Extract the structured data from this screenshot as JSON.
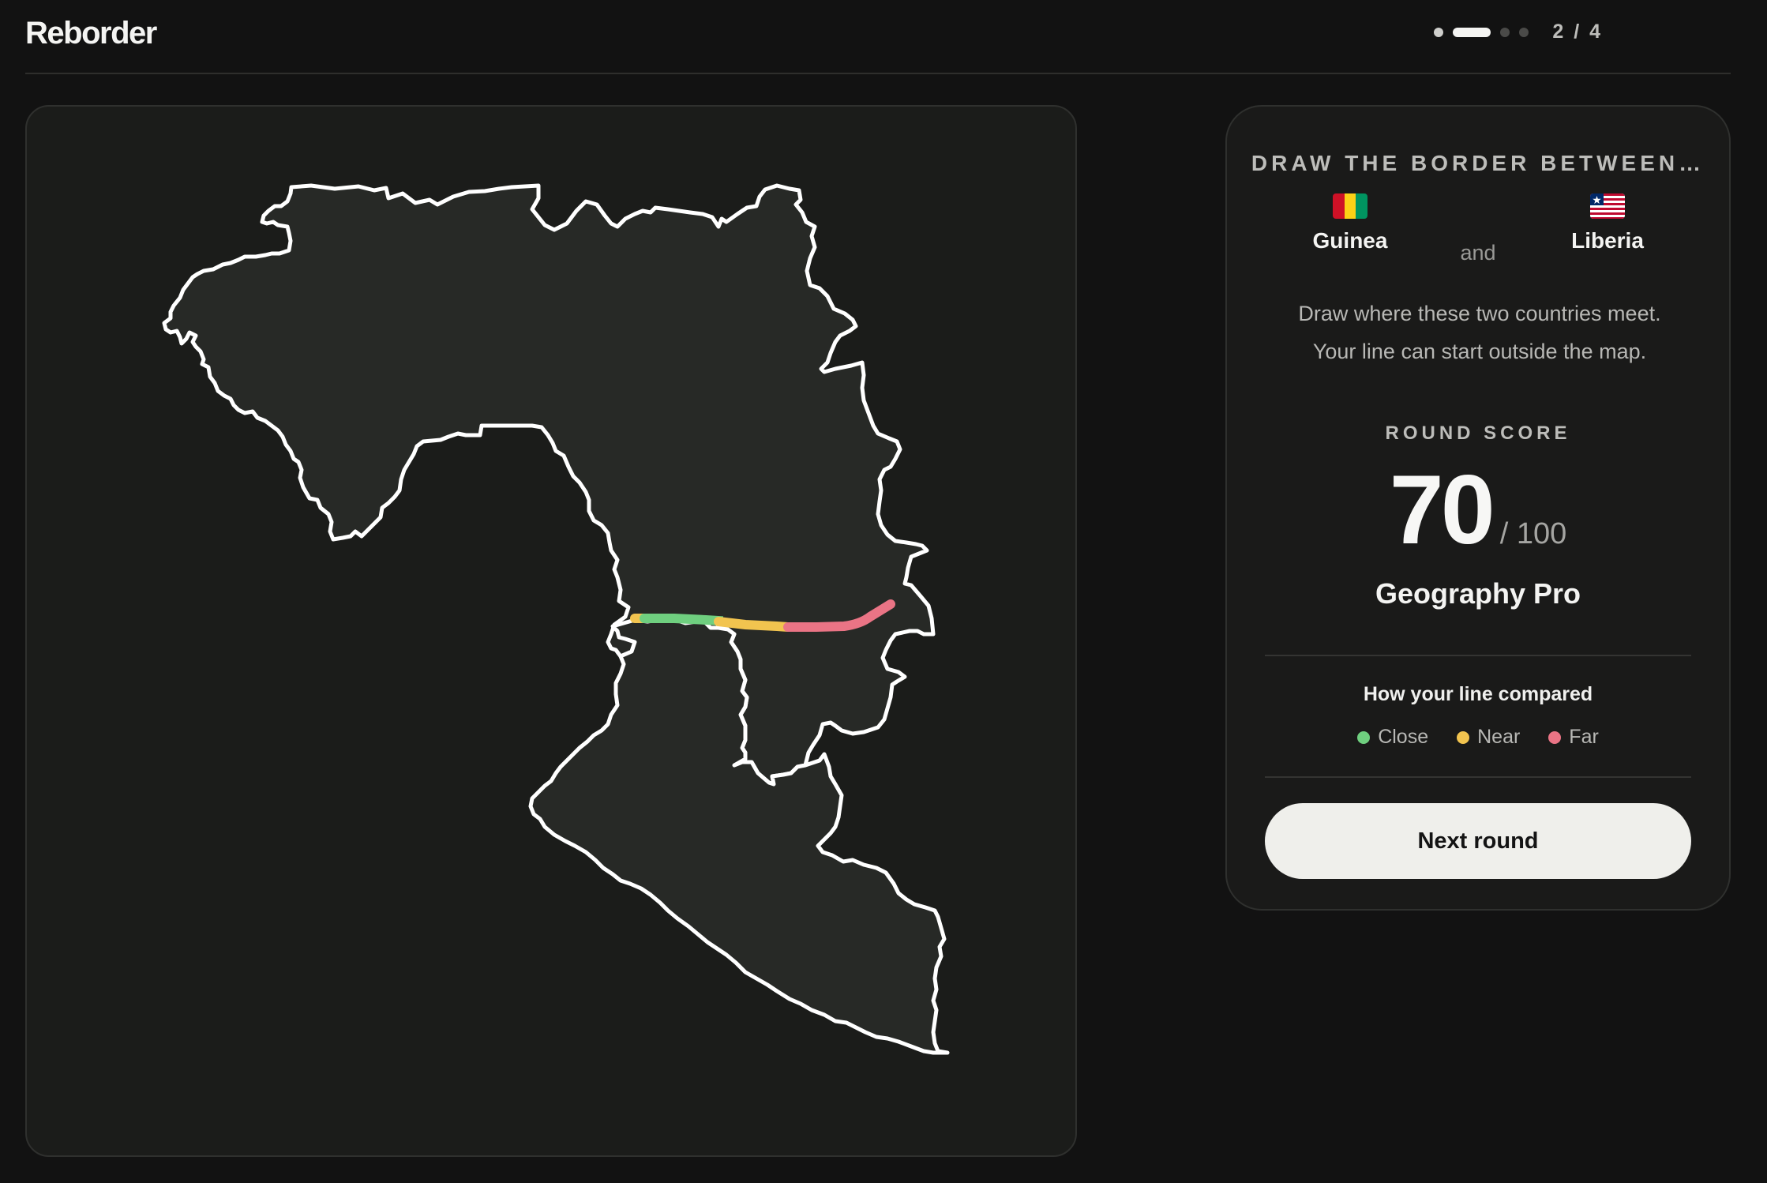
{
  "app": {
    "title": "Reborder"
  },
  "progress": {
    "current": 2,
    "total": 4,
    "label": "2 / 4"
  },
  "prompt": {
    "title": "DRAW THE BORDER BETWEEN…",
    "country_a": {
      "name": "Guinea",
      "flag_icon": "guinea-flag-icon"
    },
    "connector": "and",
    "country_b": {
      "name": "Liberia",
      "flag_icon": "liberia-flag-icon"
    },
    "instructions_line1": "Draw where these two countries meet.",
    "instructions_line2": "Your line can start outside the map."
  },
  "score": {
    "label": "ROUND SCORE",
    "value": "70",
    "max": "/ 100",
    "rank": "Geography Pro"
  },
  "comparison": {
    "title": "How your line compared",
    "legend": [
      {
        "label": "Close",
        "color": "#6fcf7f"
      },
      {
        "label": "Near",
        "color": "#f2c44f"
      },
      {
        "label": "Far",
        "color": "#ea7485"
      }
    ]
  },
  "actions": {
    "next_label": "Next round"
  },
  "colors": {
    "background": "#121212",
    "card": "#1b1c1a",
    "land": "#272926",
    "border_outline": "#ffffff",
    "accent_button": "#efefeb"
  }
}
